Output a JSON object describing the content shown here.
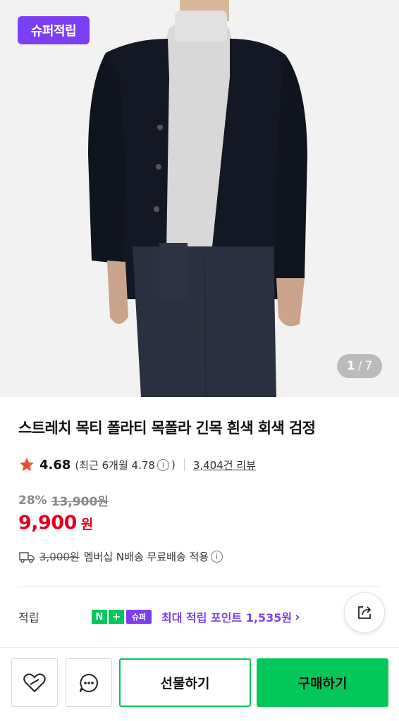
{
  "hero": {
    "badge": "슈퍼적립",
    "pager_current": "1",
    "pager_sep": "/",
    "pager_total": "7"
  },
  "product": {
    "title": "스트레치 목티 폴라티 목폴라 긴목 흰색 회색 검정",
    "rating": "4.68",
    "recent_rating_text": "(최근 6개월 4.78",
    "recent_close": ")",
    "review_count": "3,404건 리뷰",
    "discount": "28%",
    "original_price": "13,900원",
    "price": "9,900",
    "currency": "원",
    "shipping_fee": "3,000원",
    "shipping_note": "멤버십 N배송 무료배송 적용"
  },
  "points": {
    "label": "적립",
    "n": "N",
    "plus": "+",
    "super": "슈퍼",
    "text": "최대 적립 포인트 1,535원",
    "chevron": "›"
  },
  "actions": {
    "gift": "선물하기",
    "buy": "구매하기"
  },
  "colors": {
    "accent_green": "#03c75a",
    "accent_purple": "#7b3ff2",
    "price_red": "#e2001a"
  },
  "icons": [
    "heart-icon",
    "chat-icon",
    "share-icon",
    "star-icon",
    "truck-icon",
    "info-icon"
  ]
}
